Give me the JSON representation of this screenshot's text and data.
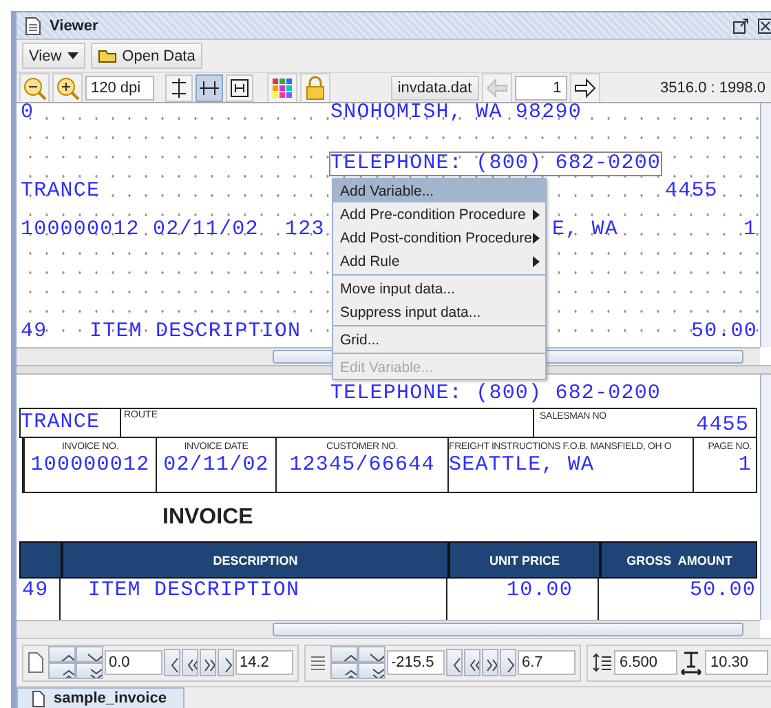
{
  "window": {
    "title": "Viewer"
  },
  "menubar": [
    {
      "label": "View",
      "kind": "dropdown"
    },
    {
      "label": "Open Data",
      "kind": "button"
    }
  ],
  "toolbar": {
    "dpi": "120 dpi",
    "toggles": [
      {
        "selected": false
      },
      {
        "selected": true
      },
      {
        "selected": false
      }
    ],
    "data_file": "invdata.dat",
    "page": "1",
    "coords": "3516.0 : 1998.0"
  },
  "editor": {
    "fields": [
      {
        "text": "0",
        "selected": false
      },
      {
        "text": "SNOHOMISH, WA 98290",
        "selected": false
      },
      {
        "text": "TELEPHONE: (800) 682-0200",
        "selected": true
      },
      {
        "text": "TRANCE",
        "selected": false
      },
      {
        "text": "4455",
        "selected": false
      },
      {
        "text": "100000012 02/11/02  123",
        "selected": false
      },
      {
        "text": "E, WA",
        "selected": false
      },
      {
        "text": "1",
        "selected": false
      },
      {
        "text": "49",
        "selected": false
      },
      {
        "text": "ITEM DESCRIPTION",
        "selected": false
      },
      {
        "text": "50.00",
        "selected": false
      }
    ]
  },
  "context_menu": {
    "groups": [
      [
        {
          "label": "Add Variable...",
          "submenu": false,
          "selected": true,
          "disabled": false
        },
        {
          "label": "Add Pre-condition Procedure",
          "submenu": true,
          "selected": false,
          "disabled": false
        },
        {
          "label": "Add Post-condition Procedure",
          "submenu": true,
          "selected": false,
          "disabled": false
        },
        {
          "label": "Add Rule",
          "submenu": true,
          "selected": false,
          "disabled": false
        }
      ],
      [
        {
          "label": "Move input data...",
          "submenu": false,
          "selected": false,
          "disabled": false
        },
        {
          "label": "Suppress input data...",
          "submenu": false,
          "selected": false,
          "disabled": false
        }
      ],
      [
        {
          "label": "Grid...",
          "submenu": false,
          "selected": false,
          "disabled": false
        }
      ],
      [
        {
          "label": "Edit Variable...",
          "submenu": false,
          "selected": false,
          "disabled": true
        }
      ]
    ]
  },
  "form": {
    "telephone": "TELEPHONE: (800) 682-0200",
    "customer": "TRANCE",
    "route_label": "ROUTE",
    "salesman_label": "SALESMAN NO",
    "salesman": "4455",
    "cells": [
      {
        "label": "INVOICE NO.",
        "value": "100000012"
      },
      {
        "label": "INVOICE DATE",
        "value": "02/11/02"
      },
      {
        "label": "CUSTOMER NO.",
        "value": "12345/66644"
      },
      {
        "label": "FREIGHT INSTRUCTIONS F.O.B. MANSFIELD, OH O",
        "value": "SEATTLE, WA"
      },
      {
        "label": "PAGE NO.",
        "value": "1"
      }
    ],
    "heading": "INVOICE",
    "columns": [
      "",
      "DESCRIPTION",
      "UNIT PRICE",
      "GROSS  AMOUNT"
    ],
    "rows": [
      [
        "49",
        "ITEM DESCRIPTION",
        "10.00",
        "50.00"
      ]
    ]
  },
  "position_controls": [
    {
      "kind": "page",
      "start": "0.0",
      "end": "14.2"
    },
    {
      "kind": "lines",
      "start": "-215.5",
      "end": "6.7"
    }
  ],
  "spacing": {
    "line_spacing": "6.500",
    "font_size": "10.30"
  },
  "tabs": [
    {
      "label": "sample_invoice",
      "selected": true
    }
  ]
}
